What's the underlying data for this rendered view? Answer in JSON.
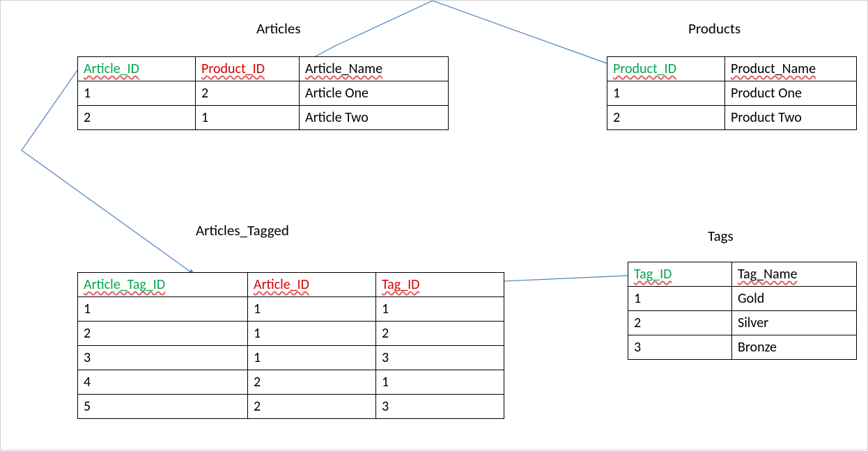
{
  "colors": {
    "pk": "#00a650",
    "fk": "#d90000",
    "arrow": "#4f81bd"
  },
  "tables": {
    "articles": {
      "title": "Articles",
      "columns": [
        "Article_ID",
        "Product_ID",
        "Article_Name"
      ],
      "column_roles": [
        "pk",
        "fk",
        "plain"
      ],
      "rows": [
        [
          "1",
          "2",
          "Article One"
        ],
        [
          "2",
          "1",
          "Article Two"
        ]
      ]
    },
    "products": {
      "title": "Products",
      "columns": [
        "Product_ID",
        "Product_Name"
      ],
      "column_roles": [
        "pk",
        "plain"
      ],
      "rows": [
        [
          "1",
          "Product One"
        ],
        [
          "2",
          "Product Two"
        ]
      ]
    },
    "articles_tagged": {
      "title": "Articles_Tagged",
      "columns": [
        "Article_Tag_ID",
        "Article_ID",
        "Tag_ID"
      ],
      "column_roles": [
        "pk",
        "fk",
        "fk"
      ],
      "rows": [
        [
          "1",
          "1",
          "1"
        ],
        [
          "2",
          "1",
          "2"
        ],
        [
          "3",
          "1",
          "3"
        ],
        [
          "4",
          "2",
          "1"
        ],
        [
          "5",
          "2",
          "3"
        ]
      ]
    },
    "tags": {
      "title": "Tags",
      "columns": [
        "Tag_ID",
        "Tag_Name"
      ],
      "column_roles": [
        "pk",
        "plain"
      ],
      "rows": [
        [
          "1",
          "Gold"
        ],
        [
          "2",
          "Silver"
        ],
        [
          "3",
          "Bronze"
        ]
      ]
    }
  },
  "relationships": [
    {
      "from": "Products.Product_ID",
      "to": "Articles.Product_ID"
    },
    {
      "from": "Articles.Article_ID",
      "to": "Articles_Tagged.Article_ID"
    },
    {
      "from": "Tags.Tag_ID",
      "to": "Articles_Tagged.Tag_ID"
    }
  ]
}
